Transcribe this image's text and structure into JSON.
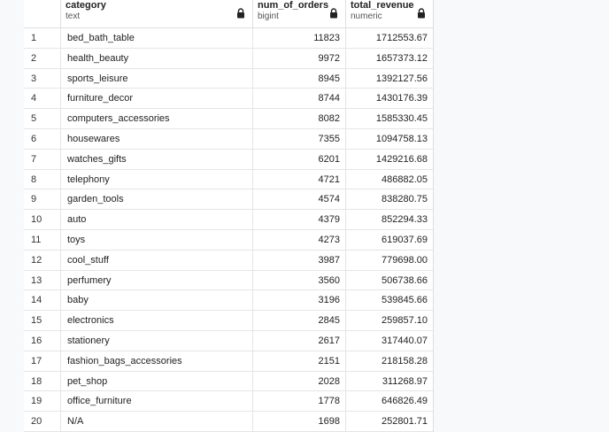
{
  "columns": [
    {
      "name": "category",
      "type": "text"
    },
    {
      "name": "num_of_orders",
      "type": "bigint"
    },
    {
      "name": "total_revenue",
      "type": "numeric"
    }
  ],
  "rows": [
    {
      "n": "1",
      "category": "bed_bath_table",
      "orders": "11823",
      "revenue": "1712553.67"
    },
    {
      "n": "2",
      "category": "health_beauty",
      "orders": "9972",
      "revenue": "1657373.12"
    },
    {
      "n": "3",
      "category": "sports_leisure",
      "orders": "8945",
      "revenue": "1392127.56"
    },
    {
      "n": "4",
      "category": "furniture_decor",
      "orders": "8744",
      "revenue": "1430176.39"
    },
    {
      "n": "5",
      "category": "computers_accessories",
      "orders": "8082",
      "revenue": "1585330.45"
    },
    {
      "n": "6",
      "category": "housewares",
      "orders": "7355",
      "revenue": "1094758.13"
    },
    {
      "n": "7",
      "category": "watches_gifts",
      "orders": "6201",
      "revenue": "1429216.68"
    },
    {
      "n": "8",
      "category": "telephony",
      "orders": "4721",
      "revenue": "486882.05"
    },
    {
      "n": "9",
      "category": "garden_tools",
      "orders": "4574",
      "revenue": "838280.75"
    },
    {
      "n": "10",
      "category": "auto",
      "orders": "4379",
      "revenue": "852294.33"
    },
    {
      "n": "11",
      "category": "toys",
      "orders": "4273",
      "revenue": "619037.69"
    },
    {
      "n": "12",
      "category": "cool_stuff",
      "orders": "3987",
      "revenue": "779698.00"
    },
    {
      "n": "13",
      "category": "perfumery",
      "orders": "3560",
      "revenue": "506738.66"
    },
    {
      "n": "14",
      "category": "baby",
      "orders": "3196",
      "revenue": "539845.66"
    },
    {
      "n": "15",
      "category": "electronics",
      "orders": "2845",
      "revenue": "259857.10"
    },
    {
      "n": "16",
      "category": "stationery",
      "orders": "2617",
      "revenue": "317440.07"
    },
    {
      "n": "17",
      "category": "fashion_bags_accessories",
      "orders": "2151",
      "revenue": "218158.28"
    },
    {
      "n": "18",
      "category": "pet_shop",
      "orders": "2028",
      "revenue": "311268.97"
    },
    {
      "n": "19",
      "category": "office_furniture",
      "orders": "1778",
      "revenue": "646826.49"
    },
    {
      "n": "20",
      "category": "N/A",
      "orders": "1698",
      "revenue": "252801.71"
    }
  ]
}
